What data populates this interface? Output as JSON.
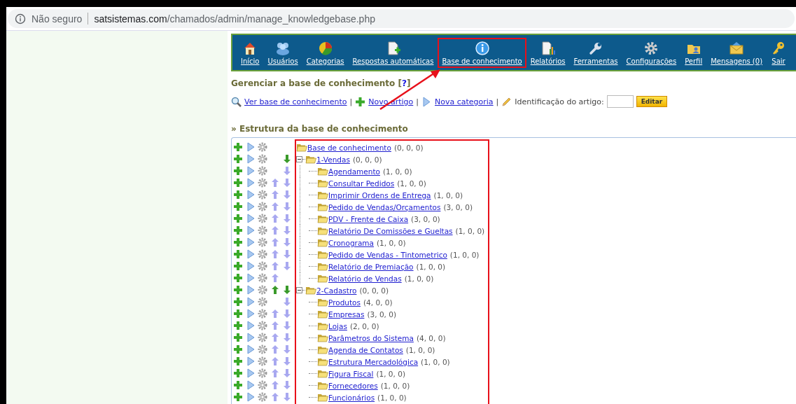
{
  "browser": {
    "security": "Não seguro",
    "host": "satsistemas.com",
    "path": "/chamados/admin/manage_knowledgebase.php"
  },
  "nav": {
    "items": [
      {
        "label": "Início",
        "highlighted": false
      },
      {
        "label": "Usuários",
        "highlighted": false
      },
      {
        "label": "Categorias",
        "highlighted": false
      },
      {
        "label": "Respostas automáticas",
        "highlighted": false
      },
      {
        "label": "Base de conhecimento",
        "highlighted": true
      },
      {
        "label": "Relatórios",
        "highlighted": false
      },
      {
        "label": "Ferramentas",
        "highlighted": false
      },
      {
        "label": "Configurações",
        "highlighted": false
      },
      {
        "label": "Perfil",
        "highlighted": false
      },
      {
        "label": "Mensagens (0)",
        "highlighted": false
      },
      {
        "label": "Sair",
        "highlighted": false
      }
    ]
  },
  "page_title": {
    "text": "Gerenciar a base de conhecimento",
    "help_open": "[",
    "help_link": "?",
    "help_close": "]"
  },
  "toolbar": [
    {
      "kind": "link",
      "label": "Ver base de conhecimento"
    },
    {
      "kind": "separator",
      "label": "|"
    },
    {
      "kind": "link",
      "label": "Novo artigo"
    },
    {
      "kind": "separator",
      "label": "|"
    },
    {
      "kind": "link",
      "label": "Nova categoria"
    },
    {
      "kind": "separator",
      "label": "|"
    },
    {
      "kind": "label",
      "label": "Identificação do artigo:"
    },
    {
      "kind": "input"
    },
    {
      "kind": "button",
      "label": "Editar"
    }
  ],
  "annotation_arrow": true,
  "section_title": "» Estrutura da base de conhecimento",
  "tree": {
    "highlighted": true,
    "root": {
      "label": "Base de conhecimento",
      "counts": "(0, 0, 0)",
      "move_up": false,
      "move_down": false,
      "children": [
        {
          "label": "1-Vendas",
          "counts": "(0, 0, 0)",
          "move_up": false,
          "move_down": true,
          "down_active": true,
          "expanded": true,
          "children": [
            {
              "label": "Agendamento",
              "counts": "(1, 0, 0)",
              "move_up": false,
              "move_down": true,
              "down_active": false
            },
            {
              "label": "Consultar Pedidos",
              "counts": "(1, 0, 0)",
              "move_up": true,
              "move_down": true,
              "up_active": false,
              "down_active": false
            },
            {
              "label": "Imprimir Ordens de Entrega",
              "counts": "(1, 0, 0)",
              "move_up": true,
              "move_down": true,
              "up_active": false,
              "down_active": false
            },
            {
              "label": "Pedido de Vendas/Orçamentos",
              "counts": "(3, 0, 0)",
              "move_up": true,
              "move_down": true,
              "up_active": false,
              "down_active": false
            },
            {
              "label": "PDV - Frente de Caixa",
              "counts": "(3, 0, 0)",
              "move_up": true,
              "move_down": true,
              "up_active": false,
              "down_active": false
            },
            {
              "label": "Relatório De Comissões e Gueltas",
              "counts": "(1, 0, 0)",
              "move_up": true,
              "move_down": true,
              "up_active": false,
              "down_active": false
            },
            {
              "label": "Cronograma",
              "counts": "(1, 0, 0)",
              "move_up": true,
              "move_down": true,
              "up_active": false,
              "down_active": false
            },
            {
              "label": "Pedido de Vendas - Tintometrico",
              "counts": "(1, 0, 0)",
              "move_up": true,
              "move_down": true,
              "up_active": false,
              "down_active": false
            },
            {
              "label": "Relatório de Premiação",
              "counts": "(1, 0, 0)",
              "move_up": true,
              "move_down": true,
              "up_active": false,
              "down_active": false
            },
            {
              "label": "Relatório de Vendas",
              "counts": "(1, 0, 0)",
              "move_up": true,
              "move_down": false,
              "up_active": false
            }
          ]
        },
        {
          "label": "2-Cadastro",
          "counts": "(0, 0, 0)",
          "move_up": true,
          "move_down": true,
          "up_active": true,
          "down_active": true,
          "expanded": true,
          "children": [
            {
              "label": "Produtos",
              "counts": "(4, 0, 0)",
              "move_up": false,
              "move_down": true,
              "down_active": false
            },
            {
              "label": "Empresas",
              "counts": "(3, 0, 0)",
              "move_up": true,
              "move_down": true,
              "up_active": false,
              "down_active": false
            },
            {
              "label": "Lojas",
              "counts": "(2, 0, 0)",
              "move_up": true,
              "move_down": true,
              "up_active": false,
              "down_active": false
            },
            {
              "label": "Parâmetros do Sistema",
              "counts": "(4, 0, 0)",
              "move_up": true,
              "move_down": true,
              "up_active": false,
              "down_active": false
            },
            {
              "label": "Agenda de Contatos",
              "counts": "(1, 0, 0)",
              "move_up": true,
              "move_down": true,
              "up_active": false,
              "down_active": false
            },
            {
              "label": "Estrutura Mercadológica",
              "counts": "(1, 0, 0)",
              "move_up": true,
              "move_down": true,
              "up_active": false,
              "down_active": false
            },
            {
              "label": "Figura Fiscal",
              "counts": "(1, 0, 0)",
              "move_up": true,
              "move_down": true,
              "up_active": false,
              "down_active": false
            },
            {
              "label": "Fornecedores",
              "counts": "(1, 0, 0)",
              "move_up": true,
              "move_down": true,
              "up_active": false,
              "down_active": false
            },
            {
              "label": "Funcionários",
              "counts": "(1, 0, 0)",
              "move_up": true,
              "move_down": true,
              "up_active": false,
              "down_active": false
            }
          ]
        }
      ]
    }
  }
}
